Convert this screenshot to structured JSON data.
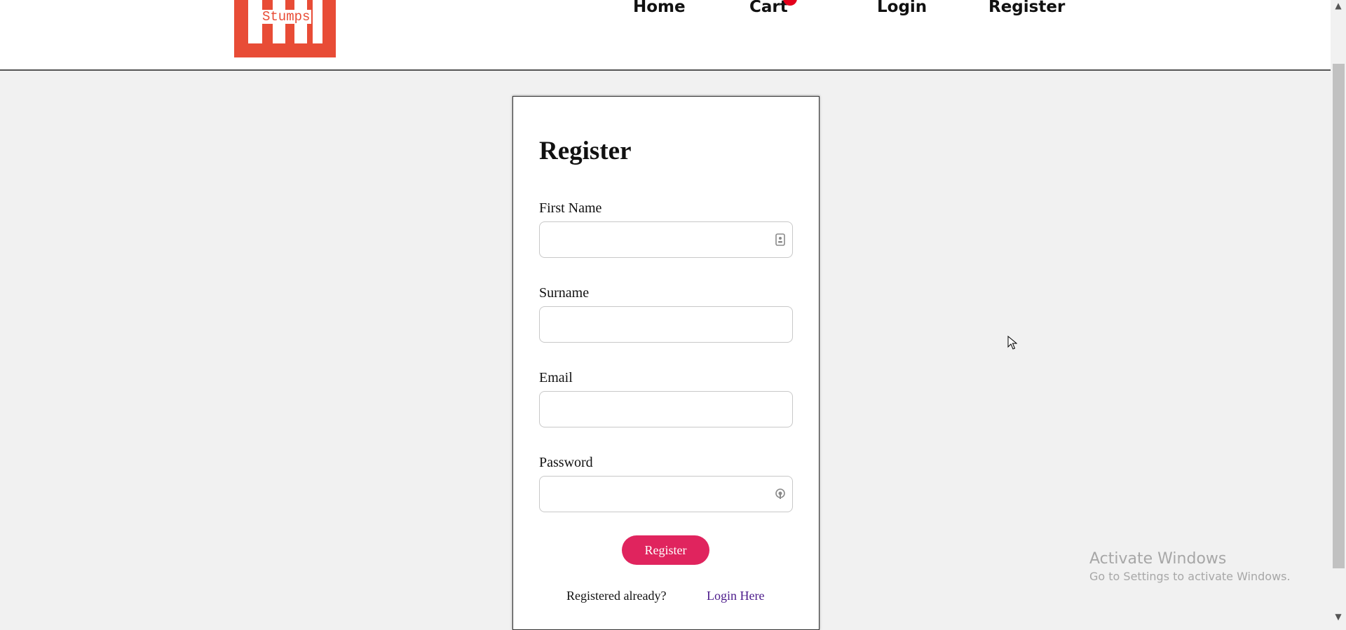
{
  "header": {
    "logo_text": "Stumps",
    "nav": {
      "home": "Home",
      "cart": "Cart",
      "login": "Login",
      "register": "Register"
    }
  },
  "form": {
    "title": "Register",
    "first_name_label": "First Name",
    "first_name_value": "",
    "surname_label": "Surname",
    "surname_value": "",
    "email_label": "Email",
    "email_value": "",
    "password_label": "Password",
    "password_value": "",
    "submit_label": "Register",
    "footer_question": "Registered already?",
    "footer_link": "Login Here"
  },
  "watermark": {
    "title": "Activate Windows",
    "subtitle": "Go to Settings to activate Windows."
  },
  "colors": {
    "accent": "#e0245e",
    "logo": "#e84c36",
    "link": "#4b1a8a",
    "badge": "#e3001b"
  }
}
